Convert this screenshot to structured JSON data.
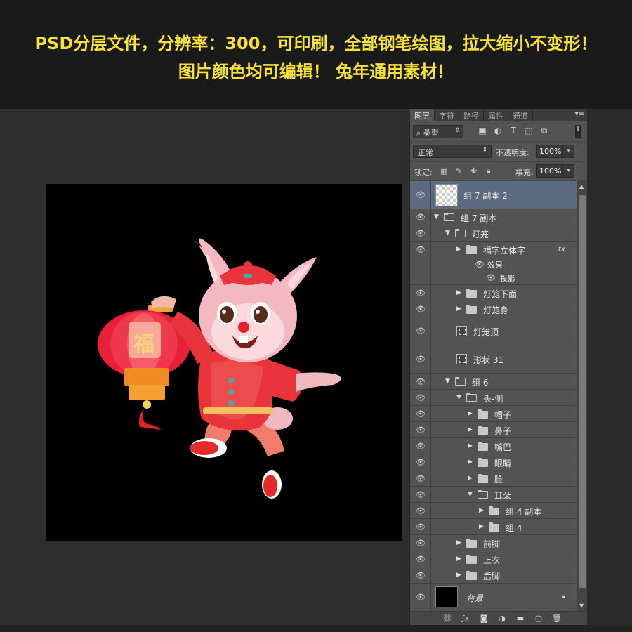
{
  "banner": {
    "line1": "PSD分层文件，分辨率：300，可印刷，全部钢笔绘图，拉大缩小不变形！",
    "line2": "图片颜色均可编辑！ 兔年通用素材！"
  },
  "canvas": {
    "lantern_char": "福"
  },
  "panel": {
    "tabs": [
      "图层",
      "字符",
      "路径",
      "属性",
      "通道"
    ],
    "filter_label": "类型",
    "blend_mode": "正常",
    "opacity_label": "不透明度:",
    "opacity_value": "100%",
    "lock_label": "锁定:",
    "fill_label": "填充:",
    "fill_value": "100%"
  },
  "layers": [
    {
      "name": "组 7 副本 2",
      "kind": "image",
      "selected": true
    },
    {
      "name": "组 7 副本",
      "kind": "folder-open"
    },
    {
      "name": "灯笼",
      "kind": "folder-open"
    },
    {
      "name": "福字立体字",
      "kind": "folder",
      "fx": "fx"
    },
    {
      "name": "效果",
      "kind": "effect"
    },
    {
      "name": "投影",
      "kind": "effect-item"
    },
    {
      "name": "灯笼下面",
      "kind": "folder"
    },
    {
      "name": "灯笼身",
      "kind": "folder"
    },
    {
      "name": "灯笼顶",
      "kind": "smart"
    },
    {
      "name": "形状 31",
      "kind": "smart"
    },
    {
      "name": "组 6",
      "kind": "folder-open"
    },
    {
      "name": "头-侧",
      "kind": "folder-open"
    },
    {
      "name": "帽子",
      "kind": "folder"
    },
    {
      "name": "鼻子",
      "kind": "folder"
    },
    {
      "name": "嘴巴",
      "kind": "folder"
    },
    {
      "name": "眼睛",
      "kind": "folder"
    },
    {
      "name": "脸",
      "kind": "folder"
    },
    {
      "name": "耳朵",
      "kind": "folder-open"
    },
    {
      "name": "组 4 副本",
      "kind": "folder"
    },
    {
      "name": "组 4",
      "kind": "folder"
    },
    {
      "name": "前脚",
      "kind": "folder"
    },
    {
      "name": "上衣",
      "kind": "folder"
    },
    {
      "name": "后脚",
      "kind": "folder"
    },
    {
      "name": "背景",
      "kind": "background"
    }
  ],
  "colors": {
    "banner_text": "#f7e23a",
    "selected_row": "#5d6b80"
  }
}
